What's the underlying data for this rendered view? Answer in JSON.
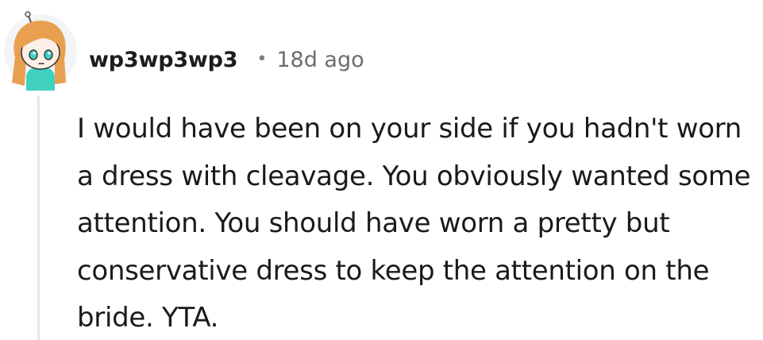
{
  "comment": {
    "author": {
      "username": "wp3wp3wp3",
      "avatar_icon": "snoo-avatar-icon"
    },
    "separator": "•",
    "timestamp": "18d ago",
    "body": "I would have been on your side if you hadn't worn a dress with cleavage. You obviously wanted some attention. You should have worn a pretty but conservative dress to keep the attention on the bride. YTA."
  },
  "colors": {
    "username": "#1c1c1c",
    "timestamp": "#6a6d70",
    "body_text": "#1a1a1a",
    "thread_line": "#e5e8ea",
    "avatar_hair": "#e8a050",
    "avatar_shirt": "#3fd0c0"
  }
}
